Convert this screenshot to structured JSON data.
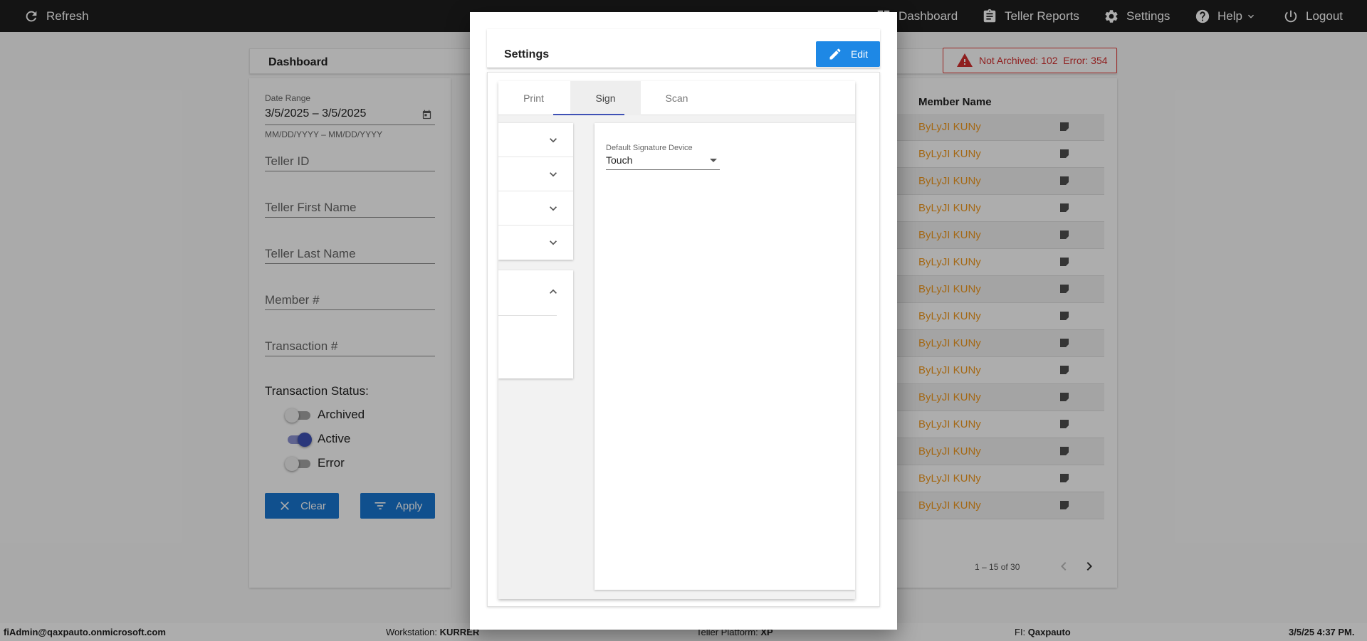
{
  "topbar": {
    "refresh": "Refresh",
    "dashboard": "Dashboard",
    "teller_reports": "Teller Reports",
    "settings": "Settings",
    "help": "Help",
    "logout": "Logout"
  },
  "dashboard": {
    "title": "Dashboard",
    "alert": "Not Archived: 102  Error: 354",
    "filters": {
      "date_range_label": "Date Range",
      "date_range_value": "3/5/2025 – 3/5/2025",
      "date_hint": "MM/DD/YYYY – MM/DD/YYYY",
      "teller_id": "Teller ID",
      "teller_first_name": "Teller First Name",
      "teller_last_name": "Teller Last Name",
      "member_no": "Member #",
      "transaction_no": "Transaction #",
      "status_title": "Transaction Status:",
      "toggles": [
        {
          "label": "Archived",
          "on": false
        },
        {
          "label": "Active",
          "on": true
        },
        {
          "label": "Error",
          "on": false
        }
      ],
      "clear": "Clear",
      "apply": "Apply"
    },
    "table": {
      "column": "Member Name",
      "rows": [
        "ByLyJI KUNy",
        "ByLyJI KUNy",
        "ByLyJI KUNy",
        "ByLyJI KUNy",
        "ByLyJI KUNy",
        "ByLyJI KUNy",
        "ByLyJI KUNy",
        "ByLyJI KUNy",
        "ByLyJI KUNy",
        "ByLyJI KUNy",
        "ByLyJI KUNy",
        "ByLyJI KUNy",
        "ByLyJI KUNy",
        "ByLyJI KUNy",
        "ByLyJI KUNy"
      ],
      "pager": "1 – 15 of 30"
    }
  },
  "modal": {
    "title": "Settings",
    "edit": "Edit",
    "tabs": [
      "Print",
      "Sign",
      "Scan"
    ],
    "active_tab": "Sign",
    "signature_label": "Default Signature Device",
    "signature_value": "Touch"
  },
  "statusbar": {
    "user": "fiAdmin@qaxpauto.onmicrosoft.com",
    "workstation_label": "Workstation:",
    "workstation_value": "KURRER",
    "platform_label": "Teller Platform:",
    "platform_value": "XP",
    "fi_label": "FI:",
    "fi_value": "Qaxpauto",
    "datetime": "3/5/25 4:37 PM."
  },
  "colors": {
    "topbar": "#1e1e1e",
    "primary_button": "#1976d2",
    "edit_button": "#1e88e5",
    "tab_ink": "#3f51b5",
    "member_name": "#f29a1f",
    "alert": "#d32f2f"
  }
}
